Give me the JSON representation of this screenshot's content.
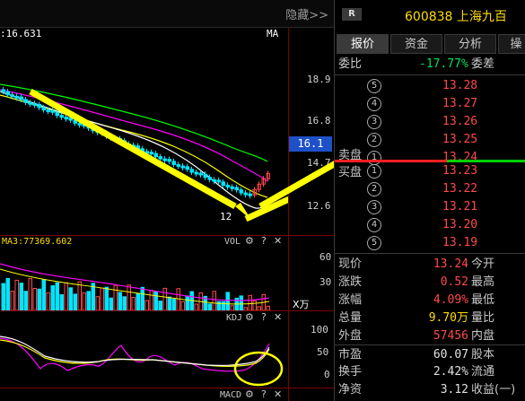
{
  "toolbar": {
    "hide_label": "隐藏>>"
  },
  "main_chart": {
    "ma_label": "MA",
    "ma_value": ":16.631",
    "y_ticks": [
      "18.9",
      "16.8",
      "14.7",
      "12.6"
    ],
    "current_price_badge": "16.1",
    "low_label": "12"
  },
  "volume": {
    "ma_label": "MA3:77369.602",
    "title": "VOL",
    "y_ticks": [
      "60",
      "30"
    ],
    "unit": "X万"
  },
  "kdj": {
    "title": "KDJ",
    "y_ticks": [
      "100",
      "50",
      "0"
    ]
  },
  "macd": {
    "title": "MACD"
  },
  "panel_icons": {
    "gear": "⚙",
    "help": "?",
    "close": "✕"
  },
  "quote": {
    "badge": "R",
    "code": "600838",
    "name": "上海九百",
    "tabs": [
      "报价",
      "资金",
      "分析",
      "操"
    ],
    "weibi_label": "委比",
    "weibi_value": "-17.77%",
    "weicha_label": "委差",
    "sell_label": "卖盘",
    "buy_label": "买盘",
    "sell_levels": [
      {
        "n": "5",
        "price": "13.28"
      },
      {
        "n": "4",
        "price": "13.27"
      },
      {
        "n": "3",
        "price": "13.26"
      },
      {
        "n": "2",
        "price": "13.25"
      },
      {
        "n": "1",
        "price": "13.24"
      }
    ],
    "buy_levels": [
      {
        "n": "1",
        "price": "13.23"
      },
      {
        "n": "2",
        "price": "13.22"
      },
      {
        "n": "3",
        "price": "13.21"
      },
      {
        "n": "4",
        "price": "13.20"
      },
      {
        "n": "5",
        "price": "13.19"
      }
    ],
    "stats": [
      {
        "l1": "现价",
        "v1": "13.24",
        "c1": "#ff4a4a",
        "l2": "今开"
      },
      {
        "l1": "涨跌",
        "v1": "0.52",
        "c1": "#ff4a4a",
        "l2": "最高"
      },
      {
        "l1": "涨幅",
        "v1": "4.09%",
        "c1": "#ff4a4a",
        "l2": "最低"
      },
      {
        "l1": "总量",
        "v1": "9.70万",
        "c1": "#ffdc00",
        "l2": "量比"
      },
      {
        "l1": "外盘",
        "v1": "57456",
        "c1": "#ff4a4a",
        "l2": "内盘"
      },
      {
        "l1": "市盈",
        "v1": "60.07",
        "c1": "#e0e0e0",
        "l2": "股本"
      },
      {
        "l1": "换手",
        "v1": "2.42%",
        "c1": "#e0e0e0",
        "l2": "流通"
      },
      {
        "l1": "净资",
        "v1": "3.12",
        "c1": "#e0e0e0",
        "l2": "收益(一)"
      }
    ]
  },
  "colors": {
    "up": "#ff4a4a",
    "down": "#00e5ff",
    "accent_yellow": "#ffdc00",
    "ma_white": "#ffffff",
    "ma_yellow": "#ffff00",
    "ma_magenta": "#ff00ff",
    "ma_green": "#00ff00",
    "badge_blue": "#1e50c8"
  }
}
